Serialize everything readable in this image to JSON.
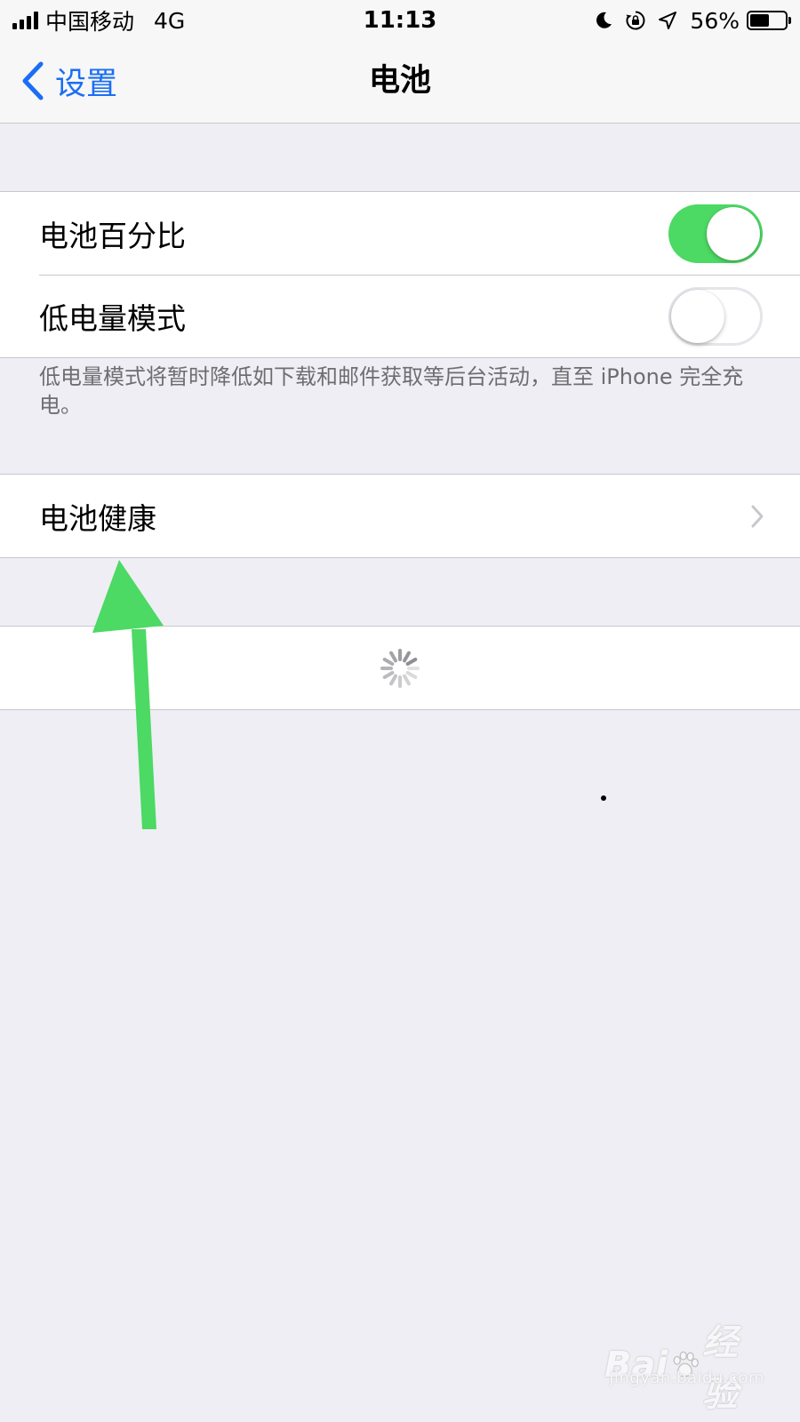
{
  "status_bar": {
    "carrier": "中国移动",
    "network": "4G",
    "time": "11:13",
    "battery_percent": "56%",
    "battery_level": 0.56,
    "icons": [
      "signal-icon",
      "moon-icon",
      "rotation-lock-icon",
      "location-icon",
      "battery-icon"
    ]
  },
  "nav": {
    "back_label": "设置",
    "title": "电池"
  },
  "battery_settings": {
    "percentage": {
      "label": "电池百分比",
      "enabled": true
    },
    "low_power": {
      "label": "低电量模式",
      "enabled": false
    },
    "footnote": "低电量模式将暂时降低如下载和邮件获取等后台活动，直至 iPhone 完全充电。"
  },
  "battery_health": {
    "label": "电池健康",
    "icon": "chevron-right-icon"
  },
  "loading": {
    "icon": "loading-spinner-icon"
  },
  "annotation": {
    "icon": "green-arrow-icon",
    "color": "#4cd964"
  },
  "colors": {
    "accent": "#1a6ef5",
    "toggle_on": "#4cd964",
    "background": "#efeef4",
    "separator": "#c8c7cc"
  },
  "watermark": {
    "main": "Bai经验",
    "sub": "jingyan.baidu.com"
  }
}
